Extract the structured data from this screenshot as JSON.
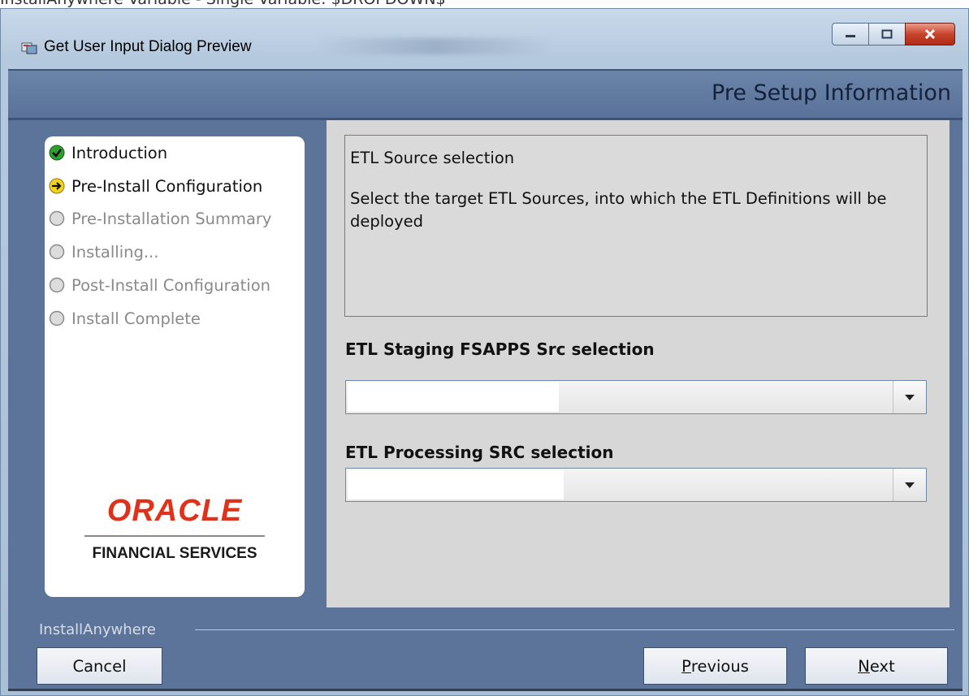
{
  "background_window": {
    "title_fragment": "InstallAnywhere Variable - Single Variable: $DROPDOWN$"
  },
  "window": {
    "title": "Get User Input Dialog Preview",
    "icon": "installer-app-icon",
    "controls": {
      "minimize": "minimize-icon",
      "maximize": "maximize-icon",
      "close": "close-icon"
    }
  },
  "header": {
    "title": "Pre Setup Information"
  },
  "steps": [
    {
      "label": "Introduction",
      "state": "done",
      "icon": "checkmark-icon"
    },
    {
      "label": "Pre-Install Configuration",
      "state": "current",
      "icon": "arrow-right-icon"
    },
    {
      "label": "Pre-Installation Summary",
      "state": "pending",
      "icon": "circle-icon"
    },
    {
      "label": "Installing...",
      "state": "pending",
      "icon": "circle-icon"
    },
    {
      "label": "Post-Install Configuration",
      "state": "pending",
      "icon": "circle-icon"
    },
    {
      "label": "Install Complete",
      "state": "pending",
      "icon": "circle-icon"
    }
  ],
  "logo": {
    "brand": "ORACLE",
    "subtitle": "FINANCIAL SERVICES",
    "color": "#e0311b"
  },
  "description": {
    "heading": "ETL Source selection",
    "body": "Select the target ETL Sources, into which the ETL Definitions will be deployed"
  },
  "fields": [
    {
      "label": "ETL Staging  FSAPPS Src selection",
      "value": ""
    },
    {
      "label": "ETL Processing SRC selection",
      "value": ""
    }
  ],
  "footer": {
    "brand": "InstallAnywhere",
    "cancel": "Cancel",
    "previous": "Previous",
    "next": "Next"
  },
  "colors": {
    "header_bg": "#5c7499",
    "content_bg": "#d7d7d7",
    "done_green": "#2e9e2e",
    "current_yellow": "#f2d21b"
  }
}
